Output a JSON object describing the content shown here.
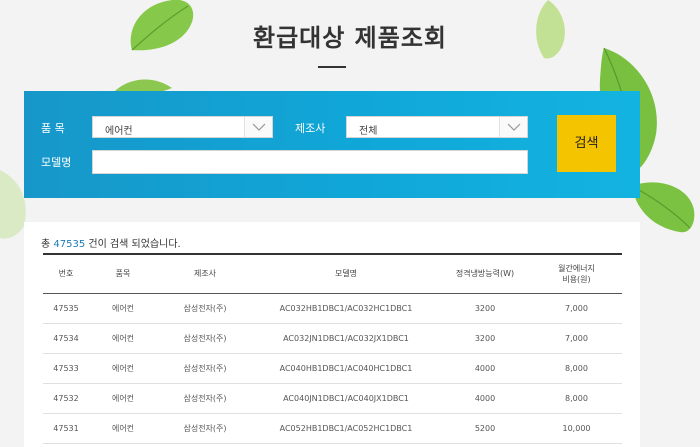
{
  "page": {
    "title": "환급대상 제품조회"
  },
  "search": {
    "item_label": "품  목",
    "item_value": "에어컨",
    "maker_label": "제조사",
    "maker_value": "전체",
    "model_label": "모델명",
    "model_value": "",
    "search_button": "검색"
  },
  "results": {
    "count_prefix": "총 ",
    "count": "47535",
    "count_suffix": " 건이 검색 되었습니다.",
    "headers": {
      "no": "번호",
      "item": "품목",
      "maker": "제조사",
      "model": "모델명",
      "capacity": "정격냉방능력(W)",
      "cost_line1": "월간에너지",
      "cost_line2": "비용(원)"
    },
    "rows": [
      {
        "no": "47535",
        "item": "에어컨",
        "maker": "삼성전자(주)",
        "model": "AC032HB1DBC1/AC032HC1DBC1",
        "capacity": "3200",
        "cost": "7,000"
      },
      {
        "no": "47534",
        "item": "에어컨",
        "maker": "삼성전자(주)",
        "model": "AC032JN1DBC1/AC032JX1DBC1",
        "capacity": "3200",
        "cost": "7,000"
      },
      {
        "no": "47533",
        "item": "에어컨",
        "maker": "삼성전자(주)",
        "model": "AC040HB1DBC1/AC040HC1DBC1",
        "capacity": "4000",
        "cost": "8,000"
      },
      {
        "no": "47532",
        "item": "에어컨",
        "maker": "삼성전자(주)",
        "model": "AC040JN1DBC1/AC040JX1DBC1",
        "capacity": "4000",
        "cost": "8,000"
      },
      {
        "no": "47531",
        "item": "에어컨",
        "maker": "삼성전자(주)",
        "model": "AC052HB1DBC1/AC052HC1DBC1",
        "capacity": "5200",
        "cost": "10,000"
      }
    ]
  },
  "colors": {
    "panel_blue": "#1797c9",
    "button_yellow": "#f5c400",
    "count_blue": "#1a7db8",
    "leaf_green": "#7cc242"
  },
  "icons": [
    "leaf-icon",
    "chevron-down-icon"
  ]
}
